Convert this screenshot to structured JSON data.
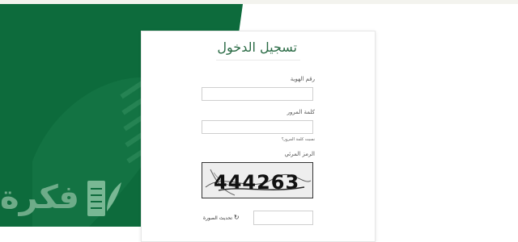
{
  "page": {
    "title": "تسجيل الدخول"
  },
  "form": {
    "id_label": "رقم الهوية",
    "id_value": "",
    "password_label": "كلمة المرور",
    "password_value": "",
    "forgot_password": "نسيت كلمة المرور؟",
    "captcha_label": "الرمز المرئي",
    "captcha_code": "444263",
    "captcha_value": "",
    "refresh_label": "تحديث الصورة",
    "refresh_icon": "refresh-icon"
  },
  "watermark": {
    "text": "فكرة",
    "logo": "book-leaf-icon"
  },
  "colors": {
    "brand_green": "#0d6b3c",
    "title_green": "#2a6b45",
    "watermark_green": "#7fb796"
  }
}
